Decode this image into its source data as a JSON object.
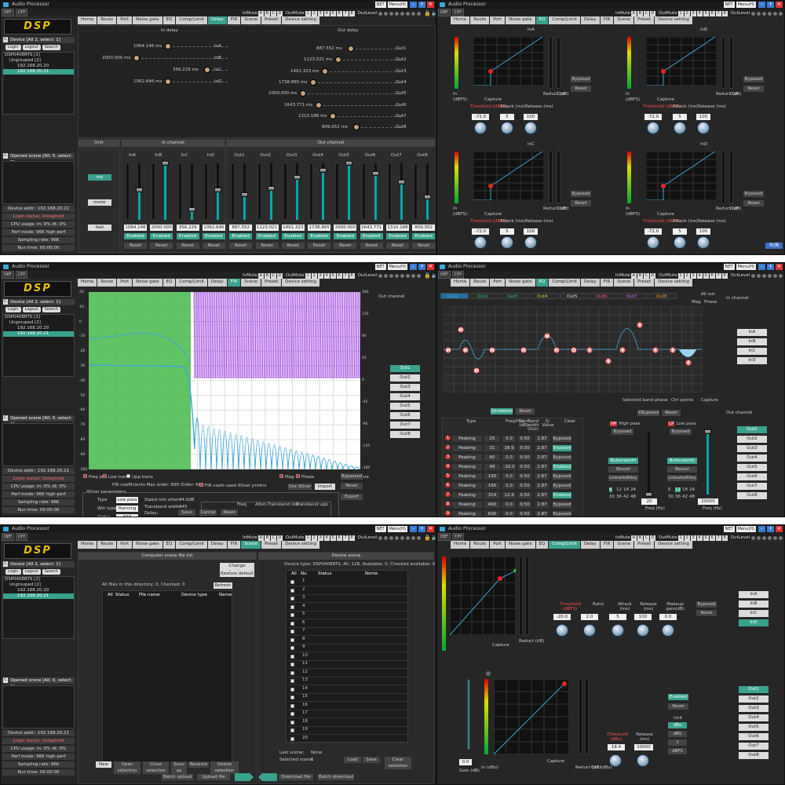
{
  "app": {
    "title": "Audio Processor",
    "def": "DEF",
    "cpy": "CPY",
    "net": "NET",
    "menu": "Menu(H)",
    "logo": "DSP"
  },
  "mute": {
    "in_label": "InMute",
    "in": [
      "A",
      "B",
      "C",
      "D"
    ],
    "out_label": "OutMute",
    "out": [
      "1",
      "2",
      "3",
      "4",
      "5",
      "6",
      "7",
      "8"
    ],
    "level_label": "OutLevel"
  },
  "tabs": [
    "Home",
    "Route",
    "Port",
    "Noise gate",
    "EQ",
    "Comp/Limit",
    "Delay",
    "FIR",
    "Scene",
    "Preset",
    "Device setting"
  ],
  "left": {
    "device_head": "Device [All 2, select: 1]",
    "login": "Login",
    "logout": "Logout",
    "search": "Search",
    "root": "DSP0408RTS [2]",
    "group": "Ungrouped [2]",
    "dev1": "192.168.20.20",
    "dev2": "192.168.20.21",
    "dev_tag": "IP",
    "scene_head": "Opened scene [All: 0, select: 0]",
    "info": [
      "Device addr.: 192.168.20.21",
      "Login status: Unlogined",
      "CPU usage: m: 0%  dt: 0%",
      "Perf mode: 96K high-perf",
      "Sampling rate: 96K",
      "Run time: 00:00:00"
    ]
  },
  "delay": {
    "in_title": "In delay",
    "out_title": "Out delay",
    "in": [
      {
        "v": "1064.146 ms",
        "n": "InA"
      },
      {
        "v": "2000.000 ms",
        "n": "InB"
      },
      {
        "v": "356.229 ms",
        "n": "InC"
      },
      {
        "v": "1062.646 ms",
        "n": "InD"
      }
    ],
    "out": [
      {
        "v": "887.552 ms",
        "n": "Out1"
      },
      {
        "v": "1123.021 ms",
        "n": "Out2"
      },
      {
        "v": "1491.323 ms",
        "n": "Out3"
      },
      {
        "v": "1738.865 ms",
        "n": "Out4"
      },
      {
        "v": "2000.000 ms",
        "n": "Out5"
      },
      {
        "v": "1643.771 ms",
        "n": "Out6"
      },
      {
        "v": "1310.188 ms",
        "n": "Out7"
      },
      {
        "v": "809.052 ms",
        "n": "Out8"
      }
    ],
    "unit_head": "Unit",
    "in_ch_head": "In channel",
    "out_ch_head": "Out channel",
    "units": [
      "ms",
      "meter",
      "feet"
    ],
    "strips": [
      {
        "n": "InA",
        "v": "1064.146",
        "lvl": 0.53
      },
      {
        "n": "InB",
        "v": "2000.000",
        "lvl": 1.0
      },
      {
        "n": "InC",
        "v": "356.229",
        "lvl": 0.18
      },
      {
        "n": "InD",
        "v": "1062.646",
        "lvl": 0.53
      },
      {
        "n": "Out1",
        "v": "887.552",
        "lvl": 0.44
      },
      {
        "n": "Out2",
        "v": "1123.021",
        "lvl": 0.56
      },
      {
        "n": "Out3",
        "v": "1491.323",
        "lvl": 0.75
      },
      {
        "n": "Out4",
        "v": "1738.865",
        "lvl": 0.87
      },
      {
        "n": "Out5",
        "v": "2000.000",
        "lvl": 1.0
      },
      {
        "n": "Out6",
        "v": "1643.771",
        "lvl": 0.82
      },
      {
        "n": "Out7",
        "v": "1310.188",
        "lvl": 0.66
      },
      {
        "n": "Out8",
        "v": "809.052",
        "lvl": 0.4
      }
    ],
    "enabled": "Enabled",
    "reset": "Reset"
  },
  "gate": {
    "channels": [
      "InA",
      "InB",
      "InC",
      "InD"
    ],
    "in_lbl": "In",
    "dbfs": "(dBFS)",
    "out_lbl": "Out",
    "reduct": "Reduct (dB)",
    "threshold": "Threshold (dBFS)",
    "attack": "Attack (ms)",
    "release": "Release (ms)",
    "th_val": "-72.0",
    "at_val": "5",
    "re_val": "100",
    "capture": "Capture",
    "bypass": "Bypssed",
    "reset": "Reset",
    "axis": [
      "0",
      "-20",
      "-40",
      "-60",
      "-80",
      "-100"
    ],
    "ime": "中/英"
  },
  "fir": {
    "out_head": "Out channel",
    "outs": [
      "Out1",
      "Out2",
      "Out3",
      "Out4",
      "Out5",
      "Out6",
      "Out7",
      "Out8"
    ],
    "freq_pt": "Freq pt",
    "low_trans": "Low trans",
    "upp_trans": "Upp trans",
    "mag": "Mag",
    "phase": "Phase",
    "capture": "Capture",
    "coef": "FIR coefficients  Max order: 895   Order: 668",
    "coef_chk": "FIR coefs used XOver prmtrs",
    "use_xover": "Use XOver",
    "import": "Import",
    "xover_head": "XOver parameters",
    "type_l": "Type",
    "type_v": "Low pass",
    "win_l": "Win type",
    "win_v": "Hanning",
    "order_l": "Order",
    "order_v": "668",
    "maxord_l": "XOver max ord",
    "maxord_v": "894",
    "stop_l": "Stpbd min atten:",
    "stop_v": "44.0dB",
    "tw_l": "Transband width:",
    "tw_v": "445",
    "dl_l": "Delay:",
    "dl_v": "3.48ms",
    "pb_l": "Passbd max atten:",
    "pb_v": "0.1dB",
    "cut_h": [
      "Freq",
      "Atten",
      "Transband low",
      "Transband upp"
    ],
    "cut_sub": [
      "Freq",
      "Atten",
      "Freq",
      "Atten"
    ],
    "cutoff": "Cutoff",
    "cut_vals": [
      "45",
      "10.8dB",
      "20",
      "10.4dB",
      "267",
      "37.9dB"
    ],
    "bypass": "Bypassed",
    "reset": "Reset",
    "export": "Export",
    "save": "Save",
    "cancel": "Cancel",
    "reset2": "Reset",
    "yl": [
      "-100",
      "-90",
      "-80",
      "-70",
      "-60",
      "-50",
      "-40",
      "-30",
      "-20",
      "-10",
      "0",
      "10",
      "20"
    ],
    "yr": [
      "180",
      "135",
      "90",
      "45",
      "0",
      "-45",
      "-90",
      "-135",
      "-180"
    ]
  },
  "eq": {
    "outs": [
      "Out1",
      "Out2",
      "Out3",
      "Out4",
      "Out5",
      "Out6",
      "Out7",
      "Out8"
    ],
    "out_colors": [
      "#3fa7d6",
      "#39c07a",
      "#39c07a",
      "#e8c547",
      "#e0e0e0",
      "#ff5577",
      "#d070ff",
      "#ff9933"
    ],
    "all_out": "All out",
    "mag": "Mag",
    "phase": "Phase",
    "in_head": "In channel",
    "ins": [
      "InA",
      "InB",
      "InC",
      "InD"
    ],
    "sel_band": "Selected band phase",
    "ctrl": "Ctrl points",
    "capture": "Capture",
    "qi": "QIndabled",
    "reset": "Reset",
    "xb": "XBypssed",
    "out_head": "Out channel",
    "hdr": [
      "Type",
      "Freq(Hz)",
      "Gain (dB)",
      "Band width (Oct)",
      "Q-Value",
      "Clear"
    ],
    "rows": [
      [
        "1",
        "Peaking",
        "25",
        "0.0",
        "0.50",
        "2.87",
        "Bypssed"
      ],
      [
        "2",
        "Peaking",
        "31",
        "16.9",
        "0.50",
        "2.87",
        "Enabled"
      ],
      [
        "3",
        "Peaking",
        "40",
        "0.0",
        "0.50",
        "2.87",
        "Bypssed"
      ],
      [
        "4",
        "Peaking",
        "48",
        "-16.0",
        "0.50",
        "2.87",
        "Enabled"
      ],
      [
        "5",
        "Peaking",
        "100",
        "0.0",
        "0.50",
        "2.87",
        "Bypssed"
      ],
      [
        "6",
        "Peaking",
        "160",
        "0.0",
        "0.50",
        "2.87",
        "Bypssed"
      ],
      [
        "7",
        "Peaking",
        "314",
        "12.4",
        "0.50",
        "2.87",
        "Enabled"
      ],
      [
        "8",
        "Peaking",
        "400",
        "0.0",
        "0.50",
        "2.87",
        "Bypssed"
      ],
      [
        "9",
        "Peaking",
        "630",
        "0.0",
        "0.50",
        "2.87",
        "Bypssed"
      ]
    ],
    "hp": "High pass",
    "lp": "Low pass",
    "hp_tag": "HP",
    "lp_tag": "LP",
    "byp": "Bypssed",
    "filters": [
      "Butterworth",
      "Bessel",
      "LinkwitzRiley"
    ],
    "slopes": [
      "6",
      "12",
      "18",
      "24",
      "30",
      "36",
      "42",
      "48"
    ],
    "hp_freq": "20",
    "lp_freq": "20000",
    "freq_unit": "Freq (Hz)",
    "pts": [
      "2",
      "1",
      "3",
      "4",
      "5",
      "6",
      "7",
      "8",
      "9",
      "10",
      "11",
      "12",
      "13",
      "14",
      "15",
      "16"
    ]
  },
  "scene": {
    "list_title": "Computer scene file list",
    "change_dir": "Change directory",
    "restore": "Restore default",
    "files": "All files in this directory: 0, Checked: 0",
    "refresh": "Refresh",
    "cols": [
      "All",
      "Status",
      "File name",
      "Device type",
      "Name"
    ],
    "btns": [
      "New",
      "Open selection",
      "Close selection",
      "Save as",
      "Rename",
      "Delete selection"
    ],
    "dev_title": "Device scene",
    "dev_info": "Device type: DSP0408RTS, All: 128, Available: 0, Checked available: 0",
    "dev_cols": [
      "All",
      "No.",
      "Status",
      "Name"
    ],
    "last_l": "Last scene:",
    "last_v": "None",
    "sel_l": "Selected scene:",
    "sel_v": "1",
    "dev_btns": [
      "Load",
      "Save",
      "Clear selection"
    ],
    "bottom": [
      "Batch upload",
      "Upload file",
      "Download file",
      "Batch download"
    ],
    "nums": [
      "1",
      "2",
      "3",
      "4",
      "5",
      "6",
      "7",
      "8",
      "9",
      "10",
      "11",
      "12",
      "13",
      "14",
      "15",
      "16",
      "17",
      "18",
      "19",
      "20"
    ]
  },
  "comp": {
    "threshold": "Threshold (dBFS)",
    "ratio": "Ratio",
    "attack": "Attack (ms)",
    "release": "Release (ms)",
    "makeup": "Makeup gain(dB)",
    "th_v": "-20.0",
    "ra_v": "2.0",
    "at_v": "5",
    "re_v": "100",
    "mk_v": "0.0",
    "bypass": "Bypssed",
    "reset": "Reset",
    "capture": "Capture",
    "ins": [
      "InA",
      "InB",
      "InC",
      "InD"
    ],
    "outs": [
      "Out1",
      "Out2",
      "Out3",
      "Out4",
      "Out5",
      "Out6",
      "Out7",
      "Out8"
    ],
    "axis": [
      "0",
      "-12",
      "-24",
      "-36",
      "-48",
      "-60",
      "-72"
    ],
    "in_l": "In (dBFS)",
    "reduct": "Reduct (dB)",
    "out_l": "Out (dBFS)",
    "lim_th": "Threshold (dBu)",
    "lim_re": "Release (ms)",
    "lim_th_v": "18.4",
    "lim_re_v": "10000",
    "enabled": "Enabled",
    "unit": "Unit",
    "units": [
      "dBu",
      "dBV",
      "V",
      "dBFS"
    ],
    "gain": "Gain (dB)",
    "gain_v": "0.0",
    "in_dbu": "In (dBu)",
    "out_dbu": "Out (dBu)",
    "lim_axis": [
      "12",
      "0",
      "-12",
      "-24",
      "-36",
      "-48",
      "-60"
    ]
  }
}
